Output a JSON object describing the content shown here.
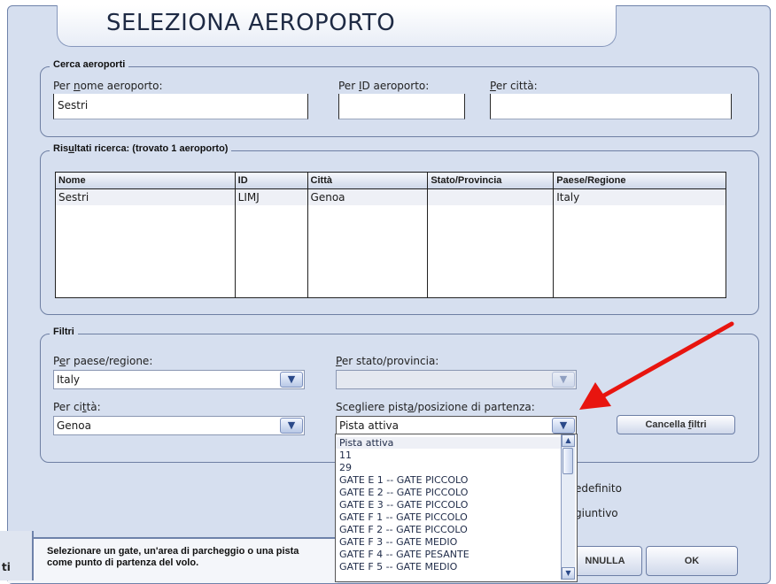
{
  "window": {
    "title": "SELEZIONA AEROPORTO"
  },
  "search": {
    "legend": "Cerca aeroporti",
    "name_label_pre": "Per ",
    "name_label_ul": "n",
    "name_label_post": "ome aeroporto:",
    "name_value": "Sestri",
    "id_label_pre": "Per ",
    "id_label_ul": "I",
    "id_label_post": "D aeroporto:",
    "id_value": "",
    "city_label_ul": "P",
    "city_label_post": "er città:",
    "city_value": ""
  },
  "results": {
    "legend_pre": "Ris",
    "legend_ul": "u",
    "legend_post": "ltati ricerca: (trovato 1 aeroporto)",
    "columns": [
      "Nome",
      "ID",
      "Città",
      "Stato/Provincia",
      "Paese/Regione"
    ],
    "rows": [
      [
        "Sestri",
        "LIMJ",
        "Genoa",
        "",
        "Italy"
      ]
    ]
  },
  "filters": {
    "legend": "Filtri",
    "country_label_pre": "P",
    "country_label_ul": "e",
    "country_label_post": "r paese/regione:",
    "country_value": "Italy",
    "state_label_pre": "",
    "state_label_ul": "P",
    "state_label_post": "er stato/provincia:",
    "state_value": "",
    "city_label_pre": "Per ci",
    "city_label_ul": "t",
    "city_label_post": "tà:",
    "city_value": "Genoa",
    "runway_label_pre": "Scegliere pist",
    "runway_label_ul": "a",
    "runway_label_post": "/posizione di partenza:",
    "runway_value": "Pista attiva",
    "clear_pre": "Cancella ",
    "clear_ul": "f",
    "clear_post": "iltri"
  },
  "runway_options": [
    "Pista attiva",
    "11",
    "29",
    "GATE E 1 -- GATE PICCOLO",
    "GATE E 2 -- GATE PICCOLO",
    "GATE E 3 -- GATE PICCOLO",
    "GATE F 1 -- GATE PICCOLO",
    "GATE F 2 -- GATE PICCOLO",
    "GATE F 3 -- GATE MEDIO",
    "GATE F 4 -- GATE PESANTE",
    "GATE F 5 -- GATE MEDIO"
  ],
  "partial": {
    "default_text": "edefinito",
    "extra_text": "giuntivo",
    "left_tab": "ti"
  },
  "status": {
    "line1": "Selezionare un gate, un'area di parcheggio o una pista",
    "line2": "come punto di partenza del volo."
  },
  "buttons": {
    "cancel": "NNULLA",
    "ok": "OK"
  },
  "colors": {
    "dialog_bg": "#d6dfef",
    "arrow": "#e8150f",
    "selection": "#eef0f6"
  }
}
